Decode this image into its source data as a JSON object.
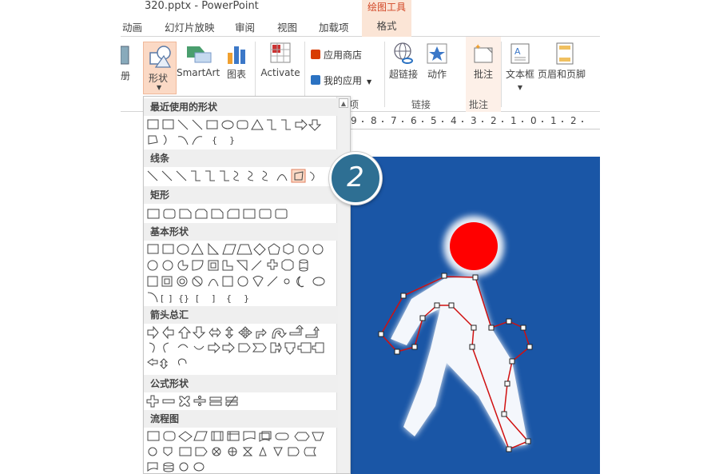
{
  "window": {
    "title": "320.pptx - PowerPoint",
    "context_tool_label": "绘图工具"
  },
  "tabs": [
    {
      "label": "动画"
    },
    {
      "label": "幻灯片放映"
    },
    {
      "label": "审阅"
    },
    {
      "label": "视图"
    },
    {
      "label": "加载项"
    },
    {
      "label": "格式"
    }
  ],
  "ribbon": {
    "partial_left_label": "册",
    "shapes_button": "形状",
    "smartart_button": "SmartArt",
    "chart_button": "图表",
    "activate_button": "Activate",
    "app_store": "应用商店",
    "my_apps": "我的应用",
    "hyperlink": "超链接",
    "action": "动作",
    "comment": "批注",
    "textbox": "文本框",
    "header_footer": "页眉和页脚",
    "group_apps_partial": "项",
    "group_links": "链接",
    "group_comments": "批注"
  },
  "dropdown": {
    "sections": [
      {
        "title": "最近使用的形状"
      },
      {
        "title": "线条"
      },
      {
        "title": "矩形"
      },
      {
        "title": "基本形状"
      },
      {
        "title": "箭头总汇"
      },
      {
        "title": "公式形状"
      },
      {
        "title": "流程图"
      }
    ]
  },
  "ruler": {
    "labels": [
      "9",
      "8",
      "7",
      "6",
      "5",
      "4",
      "3",
      "2",
      "1",
      "0",
      "1",
      "2"
    ]
  },
  "callout": {
    "number": "2"
  },
  "colors": {
    "slide_blue": "#1e5aa8",
    "context_tab": "#fbe5d6",
    "accent_orange": "#d24726",
    "head_red": "#ff0000",
    "callout_teal": "#2e6f93"
  }
}
